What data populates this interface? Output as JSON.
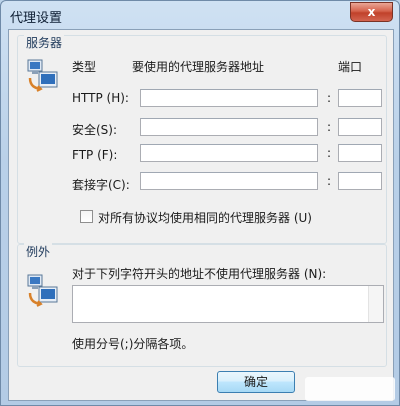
{
  "window": {
    "title": "代理设置",
    "close_glyph": "x",
    "accent_color": "#b9d0e8"
  },
  "servers": {
    "legend": "服务器",
    "icon": "network-computers-icon",
    "col_type": "类型",
    "col_address": "要使用的代理服务器地址",
    "col_port": "端口",
    "rows": [
      {
        "label": "HTTP (H):",
        "address": "",
        "port": ""
      },
      {
        "label": "安全(S):",
        "address": "",
        "port": ""
      },
      {
        "label": "FTP (F):",
        "address": "",
        "port": ""
      },
      {
        "label": "套接字(C):",
        "address": "",
        "port": ""
      }
    ],
    "colon": ":",
    "same_proxy_label": "对所有协议均使用相同的代理服务器 (U)",
    "same_proxy_checked": false
  },
  "exceptions": {
    "legend": "例外",
    "icon": "network-computers-icon",
    "prompt": "对于下列字符开头的地址不使用代理服务器 (N):",
    "value": "",
    "hint": "使用分号(;)分隔各项。"
  },
  "buttons": {
    "ok": "确定"
  }
}
